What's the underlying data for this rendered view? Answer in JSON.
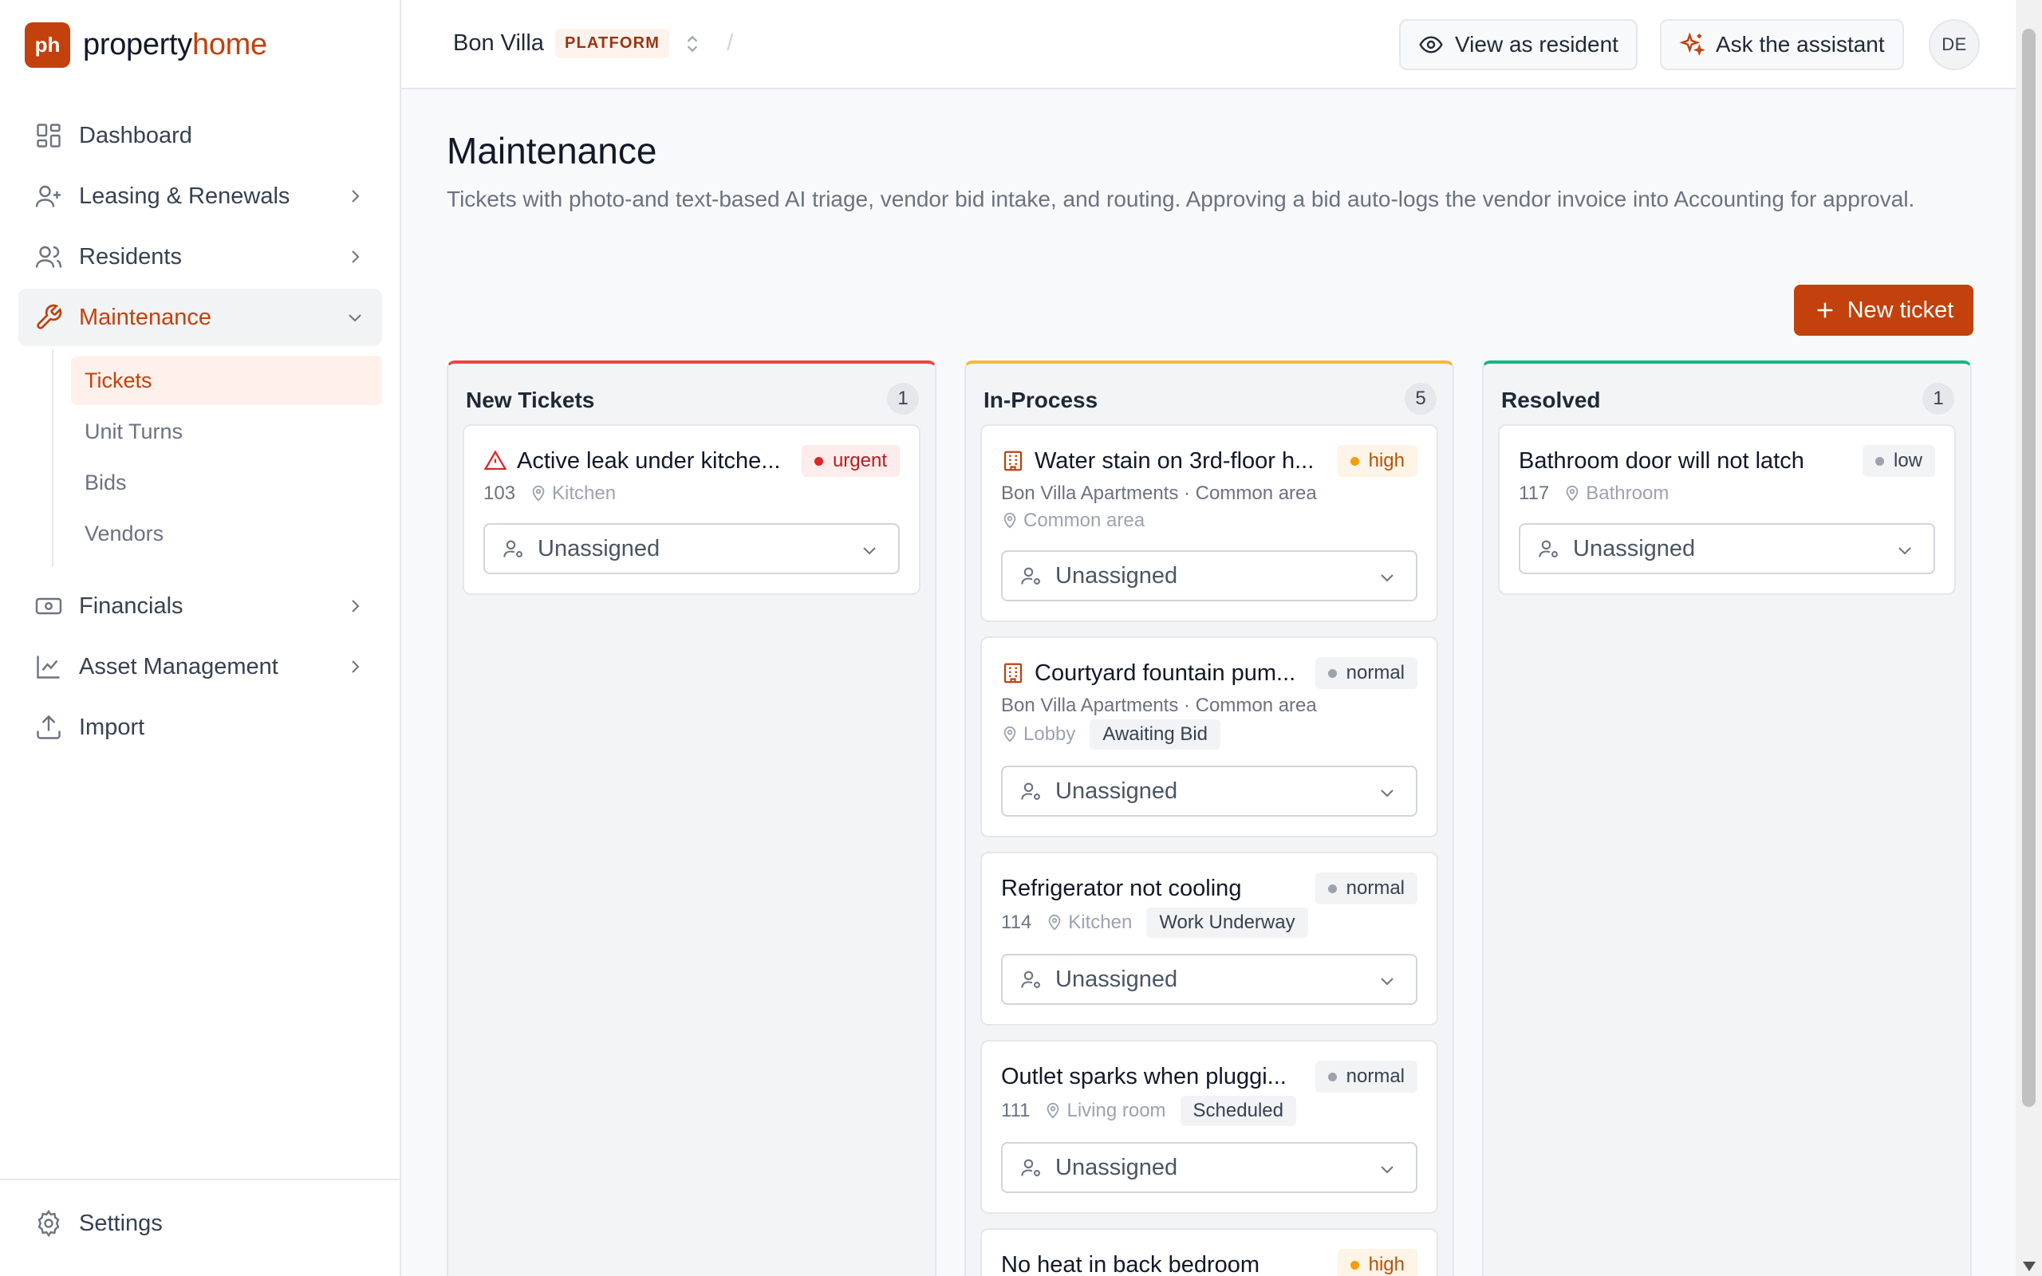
{
  "brand": {
    "logo_text": "ph",
    "name_part1": "property",
    "name_part2": "home"
  },
  "sidebar": {
    "items": [
      {
        "label": "Dashboard",
        "icon": "dashboard-icon"
      },
      {
        "label": "Leasing & Renewals",
        "icon": "user-plus-icon"
      },
      {
        "label": "Residents",
        "icon": "users-icon"
      },
      {
        "label": "Maintenance",
        "icon": "wrench-icon"
      },
      {
        "label": "Financials",
        "icon": "banknote-icon"
      },
      {
        "label": "Asset Management",
        "icon": "line-chart-icon"
      },
      {
        "label": "Import",
        "icon": "upload-icon"
      }
    ],
    "maintenance_sub": [
      "Tickets",
      "Unit Turns",
      "Bids",
      "Vendors"
    ],
    "settings_label": "Settings"
  },
  "topbar": {
    "property_name": "Bon Villa",
    "platform_badge": "PLATFORM",
    "separator": "/",
    "view_as_resident": "View as resident",
    "ask_assistant": "Ask the assistant",
    "avatar_initials": "DE"
  },
  "page": {
    "title": "Maintenance",
    "description": "Tickets with photo-and text-based AI triage, vendor bid intake, and routing. Approving a bid auto-logs the vendor invoice into Accounting for approval.",
    "new_ticket_label": "New ticket"
  },
  "colors": {
    "accent": "#c2410c",
    "new_col": "#ef4444",
    "inprocess_col": "#f5b83d",
    "resolved_col": "#10b981"
  },
  "columns": [
    {
      "title": "New Tickets",
      "count": "1",
      "cards": [
        {
          "title": "Active leak under kitche...",
          "priority": "urgent",
          "unit": "103",
          "location": "Kitchen",
          "assignee": "Unassigned"
        }
      ]
    },
    {
      "title": "In-Process",
      "count": "5",
      "cards": [
        {
          "title": "Water stain on 3rd-floor h...",
          "priority": "high",
          "building": "Bon Villa Apartments · Common area",
          "location": "Common area",
          "assignee": "Unassigned"
        },
        {
          "title": "Courtyard fountain pum...",
          "priority": "normal",
          "building": "Bon Villa Apartments · Common area",
          "location": "Lobby",
          "status": "Awaiting Bid",
          "assignee": "Unassigned"
        },
        {
          "title": "Refrigerator not cooling",
          "priority": "normal",
          "unit": "114",
          "location": "Kitchen",
          "status": "Work Underway",
          "assignee": "Unassigned"
        },
        {
          "title": "Outlet sparks when pluggi...",
          "priority": "normal",
          "unit": "111",
          "location": "Living room",
          "status": "Scheduled",
          "assignee": "Unassigned"
        },
        {
          "title": "No heat in back bedroom",
          "priority": "high"
        }
      ]
    },
    {
      "title": "Resolved",
      "count": "1",
      "cards": [
        {
          "title": "Bathroom door will not latch",
          "priority": "low",
          "unit": "117",
          "location": "Bathroom",
          "assignee": "Unassigned"
        }
      ]
    }
  ]
}
